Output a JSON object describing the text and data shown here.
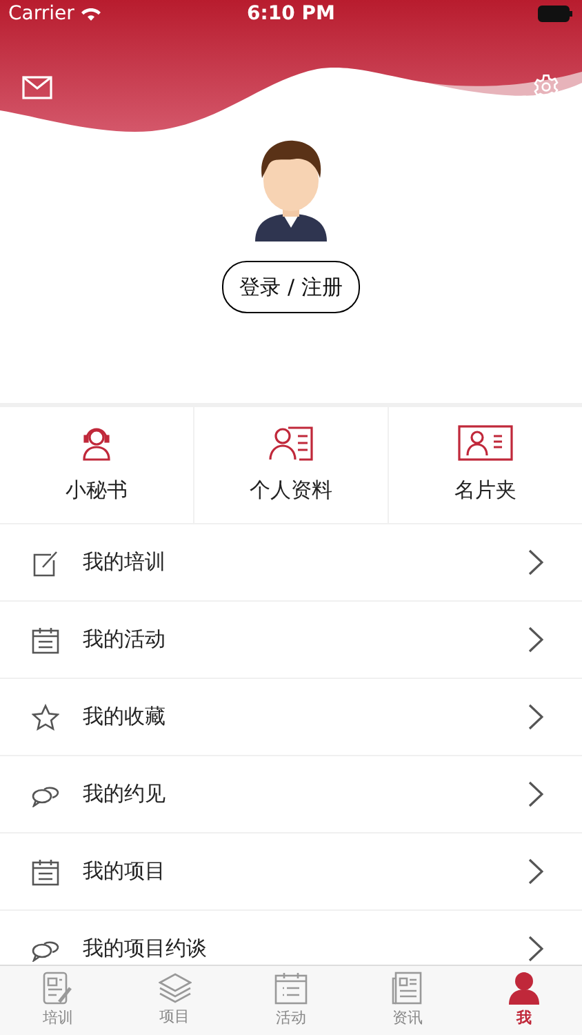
{
  "status_bar": {
    "carrier": "Carrier",
    "time": "6:10 PM"
  },
  "login_button": "登录 / 注册",
  "shortcuts": [
    {
      "kind": "headset",
      "label": "小秘书"
    },
    {
      "kind": "profile",
      "label": "个人资料"
    },
    {
      "kind": "card",
      "label": "名片夹"
    }
  ],
  "menu": [
    {
      "kind": "edit",
      "label": "我的培训"
    },
    {
      "kind": "calendar",
      "label": "我的活动"
    },
    {
      "kind": "star",
      "label": "我的收藏"
    },
    {
      "kind": "chat",
      "label": "我的约见"
    },
    {
      "kind": "calendar",
      "label": "我的项目"
    },
    {
      "kind": "chat",
      "label": "我的项目约谈"
    }
  ],
  "tab_bar": [
    {
      "kind": "doc",
      "label": "培训",
      "selected": false
    },
    {
      "kind": "layers",
      "label": "项目",
      "selected": false
    },
    {
      "kind": "calendar",
      "label": "活动",
      "selected": false
    },
    {
      "kind": "news",
      "label": "资讯",
      "selected": false
    },
    {
      "kind": "person",
      "label": "我",
      "selected": true
    }
  ]
}
